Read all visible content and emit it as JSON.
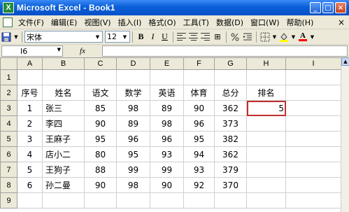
{
  "window": {
    "title": "Microsoft Excel - Book1",
    "app_icon_letter": "X",
    "minimize": "_",
    "maximize": "□",
    "close": "×"
  },
  "menu": {
    "items": [
      "文件(F)",
      "编辑(E)",
      "视图(V)",
      "插入(I)",
      "格式(O)",
      "工具(T)",
      "数据(D)",
      "窗口(W)",
      "帮助(H)"
    ],
    "doc_close": "×"
  },
  "toolbar": {
    "font_name": "宋体",
    "font_size": "12",
    "bold_label": "B",
    "italic_label": "I",
    "underline_label": "U",
    "merge_label": "⊞",
    "font_color_label": "A",
    "fill_color": "#ffff00",
    "font_color": "#ff0000",
    "icons": [
      "save-icon",
      "chevron-down-icon",
      "bold-icon",
      "italic-icon",
      "underline-icon",
      "align-left-icon",
      "align-center-icon",
      "align-right-icon",
      "merge-center-icon",
      "percent-icon",
      "indent-icon",
      "borders-icon",
      "fill-color-icon",
      "font-color-icon"
    ]
  },
  "formula_bar": {
    "name_box": "I6",
    "fx_label": "fx",
    "formula": ""
  },
  "sheet": {
    "columns": [
      "A",
      "B",
      "C",
      "D",
      "E",
      "F",
      "G",
      "H",
      "I"
    ],
    "rows": [
      "1",
      "2",
      "3",
      "4",
      "5",
      "6",
      "7",
      "8",
      "9"
    ],
    "headers": [
      "序号",
      "姓名",
      "语文",
      "数学",
      "英语",
      "体育",
      "总分",
      "排名"
    ],
    "data": [
      [
        "1",
        "张三",
        "85",
        "98",
        "89",
        "90",
        "362",
        "5"
      ],
      [
        "2",
        "李四",
        "90",
        "89",
        "98",
        "96",
        "373",
        ""
      ],
      [
        "3",
        "王麻子",
        "95",
        "96",
        "96",
        "95",
        "382",
        ""
      ],
      [
        "4",
        "店小二",
        "80",
        "95",
        "93",
        "94",
        "362",
        ""
      ],
      [
        "5",
        "王狗子",
        "88",
        "99",
        "99",
        "93",
        "379",
        ""
      ],
      [
        "6",
        "孙二曼",
        "90",
        "98",
        "90",
        "92",
        "370",
        ""
      ]
    ],
    "selected_cell_border": "#c0302d"
  }
}
